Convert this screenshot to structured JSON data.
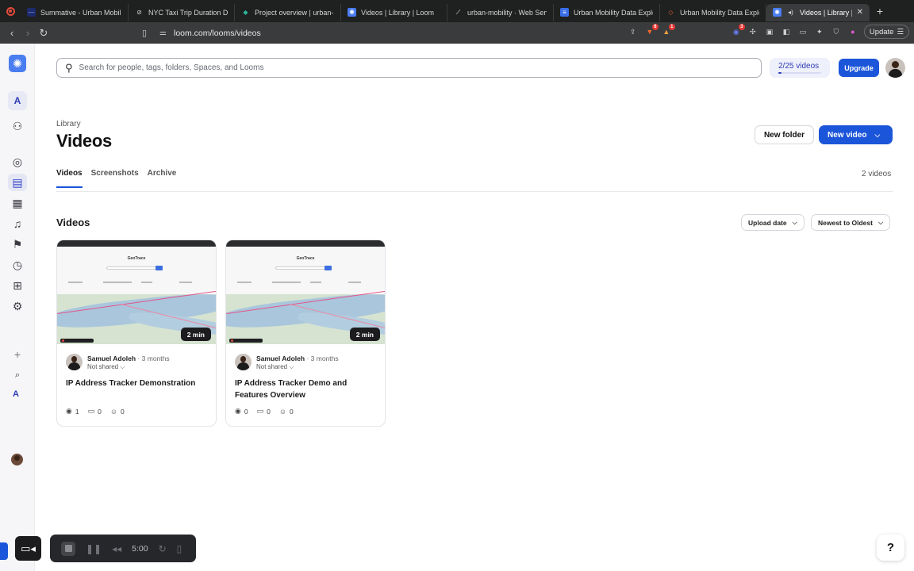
{
  "browser": {
    "tabs": [
      {
        "title": "Summative - Urban Mobility",
        "favicon": "dash-icon",
        "color": "#3a6ee8",
        "active": false
      },
      {
        "title": "NYC Taxi Trip Duration Dataset",
        "favicon": "globe-icon",
        "color": "#8a8a8a",
        "active": false
      },
      {
        "title": "Project overview | urban-mobility",
        "favicon": "diamond-icon",
        "color": "#2bb39a",
        "active": false
      },
      {
        "title": "Videos | Library | Loom",
        "favicon": "loom-icon",
        "color": "#4a7df0",
        "active": false
      },
      {
        "title": "urban-mobility · Web Service",
        "favicon": "render-icon",
        "color": "#ffffff",
        "active": false
      },
      {
        "title": "Urban Mobility Data Explorer",
        "favicon": "doc-icon",
        "color": "#3a6ee8",
        "active": false
      },
      {
        "title": "Urban Mobility Data Explorer",
        "favicon": "code-icon",
        "color": "#e8632c",
        "active": false
      },
      {
        "title": "Videos | Library | Loom",
        "favicon": "loom-icon",
        "color": "#4a7df0",
        "active": true
      }
    ],
    "url": "loom.com/looms/videos",
    "update_label": "Update",
    "ext_badges": {
      "brave": "6",
      "alert": "1",
      "profile": "3"
    }
  },
  "search": {
    "placeholder": "Search for people, tags, folders, Spaces, and Looms"
  },
  "quota": {
    "label": "2/25 videos",
    "used": 2,
    "total": 25
  },
  "upgrade_label": "Upgrade",
  "workspace_initial": "A",
  "page": {
    "breadcrumb": "Library",
    "title": "Videos",
    "new_folder_label": "New folder",
    "new_video_label": "New video",
    "tabs": [
      "Videos",
      "Screenshots",
      "Archive"
    ],
    "active_tab": "Videos",
    "video_count": "2 videos",
    "section_title": "Videos",
    "sort_by": "Upload date",
    "sort_order": "Newest to Oldest"
  },
  "videos": [
    {
      "title": "IP Address Tracker Demonstration",
      "author": "Samuel Adoleh",
      "ago": "3 months",
      "sharing": "Not shared",
      "duration": "2 min",
      "views": "1",
      "comments": "0",
      "reactions": "0",
      "thumb_heading": "GeoTrace"
    },
    {
      "title": "IP Address Tracker Demo and Features Overview",
      "author": "Samuel Adoleh",
      "ago": "3 months",
      "sharing": "Not shared",
      "duration": "2 min",
      "views": "0",
      "comments": "0",
      "reactions": "0",
      "thumb_heading": "GeoTrace"
    }
  ],
  "recorder": {
    "time": "5:00"
  },
  "help_label": "?"
}
